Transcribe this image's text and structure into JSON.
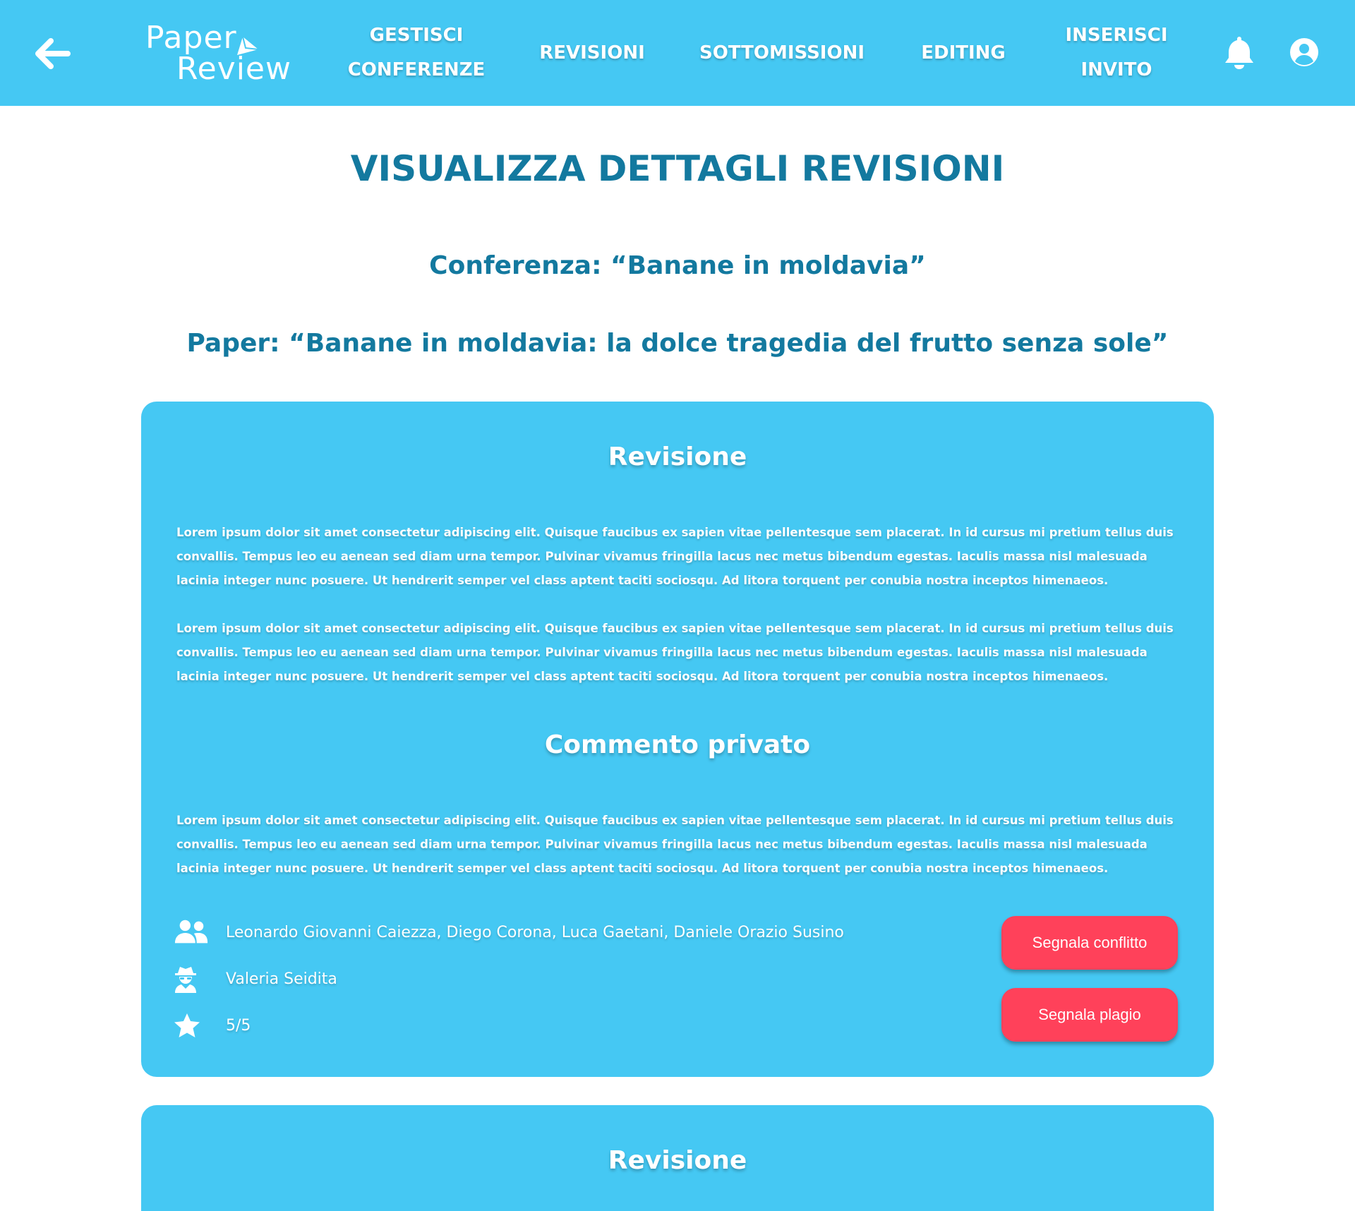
{
  "header": {
    "logo_line1": "Paper",
    "logo_line2": "Review",
    "nav": [
      {
        "label": "GESTISCI\nCONFERENZE"
      },
      {
        "label": "REVISIONI"
      },
      {
        "label": "SOTTOMISSIONI"
      },
      {
        "label": "EDITING"
      },
      {
        "label": "INSERISCI\nINVITO"
      }
    ],
    "icons": {
      "back": "arrow-left-icon",
      "notifications": "bell-icon",
      "account": "user-circle-icon"
    }
  },
  "page": {
    "title": "VISUALIZZA DETTAGLI REVISIONI",
    "conference": "Conferenza: “Banane in moldavia”",
    "paper": "Paper: “Banane in moldavia: la dolce tragedia del frutto senza sole”"
  },
  "reviews": [
    {
      "heading": "Revisione",
      "paragraphs": [
        "Lorem ipsum dolor sit amet consectetur adipiscing elit. Quisque faucibus ex sapien vitae pellentesque sem placerat. In id cursus mi pretium tellus duis convallis. Tempus leo eu aenean sed diam urna tempor. Pulvinar vivamus fringilla lacus nec metus bibendum egestas. Iaculis massa nisl malesuada lacinia integer nunc posuere. Ut hendrerit semper vel class aptent taciti sociosqu. Ad litora torquent per conubia nostra inceptos himenaeos.",
        "Lorem ipsum dolor sit amet consectetur adipiscing elit. Quisque faucibus ex sapien vitae pellentesque sem placerat. In id cursus mi pretium tellus duis convallis. Tempus leo eu aenean sed diam urna tempor. Pulvinar vivamus fringilla lacus nec metus bibendum egestas. Iaculis massa nisl malesuada lacinia integer nunc posuere. Ut hendrerit semper vel class aptent taciti sociosqu. Ad litora torquent per conubia nostra inceptos himenaeos."
      ],
      "private_heading": "Commento privato",
      "private_comment": "Lorem ipsum dolor sit amet consectetur adipiscing elit. Quisque faucibus ex sapien vitae pellentesque sem placerat. In id cursus mi pretium tellus duis convallis. Tempus leo eu aenean sed diam urna tempor. Pulvinar vivamus fringilla lacus nec metus bibendum egestas. Iaculis massa nisl malesuada lacinia integer nunc posuere. Ut hendrerit semper vel class aptent taciti sociosqu. Ad litora torquent per conubia nostra inceptos himenaeos.",
      "authors": "Leonardo Giovanni Caiezza, Diego Corona, Luca Gaetani, Daniele Orazio Susino",
      "reviewer": "Valeria Seidita",
      "score": "5/5",
      "buttons": {
        "conflict": "Segnala conflitto",
        "plagiarism": "Segnala plagio"
      }
    },
    {
      "heading": "Revisione"
    }
  ],
  "colors": {
    "header_bg": "#45c8f3",
    "card_bg": "#45c8f3",
    "title": "#13799f",
    "danger": "#ff415a"
  }
}
